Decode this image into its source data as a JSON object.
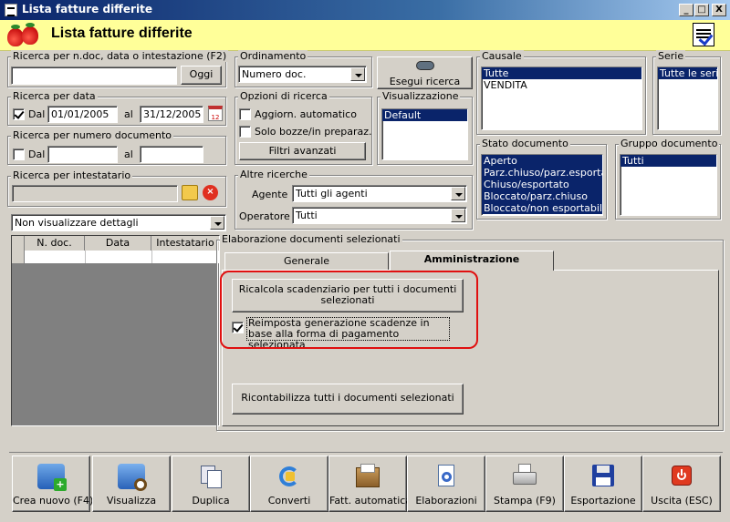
{
  "window": {
    "title": "Lista fatture differite",
    "min": "_",
    "max": "□",
    "close": "X"
  },
  "header": {
    "title": "Lista fatture differite"
  },
  "search_doc": {
    "label": "Ricerca per n.doc, data o intestazione (F2)",
    "value": "",
    "button": "Oggi"
  },
  "search_date": {
    "label": "Ricerca per data",
    "checked": true,
    "from_label": "Dal",
    "from": "01/01/2005",
    "to_label": "al",
    "to": "31/12/2005",
    "calendar_icon": "12"
  },
  "search_num": {
    "label": "Ricerca per numero documento",
    "from_label": "Dal",
    "to_label": "al",
    "from": "",
    "to": ""
  },
  "search_holder": {
    "label": "Ricerca per intestatario",
    "value": ""
  },
  "details": {
    "selected": "Non visualizzare dettagli"
  },
  "grid": {
    "columns": [
      "N. doc.",
      "Data",
      "Intestatario"
    ]
  },
  "ordering": {
    "label": "Ordinamento",
    "selected": "Numero doc."
  },
  "search_button": "Esegui ricerca",
  "options": {
    "label": "Opzioni di ricerca",
    "auto_update": "Aggiorn. automatico",
    "drafts_only": "Solo bozze/in preparaz.",
    "advanced_filters": "Filtri avanzati"
  },
  "view": {
    "label": "Visualizzazione",
    "items": [
      "Default"
    ]
  },
  "causale": {
    "label": "Causale",
    "items": [
      "Tutte",
      "VENDITA"
    ]
  },
  "serie": {
    "label": "Serie",
    "items": [
      "Tutte le serie"
    ]
  },
  "stato": {
    "label": "Stato documento",
    "items": [
      "Aperto",
      "Parz.chiuso/parz.esportato",
      "Chiuso/esportato",
      "Bloccato/parz.chiuso",
      "Bloccato/non esportabile"
    ]
  },
  "gruppo": {
    "label": "Gruppo documento",
    "items": [
      "Tutti"
    ]
  },
  "other": {
    "label": "Altre ricerche",
    "agent_label": "Agente :",
    "agent": "Tutti gli agenti",
    "operator_label": "Operatore :",
    "operator": "Tutti"
  },
  "processing": {
    "label": "Elaborazione documenti selezionati",
    "tabs": [
      "Generale",
      "Amministrazione"
    ],
    "recalc_button": "Ricalcola scadenziario per tutti i documenti selezionati",
    "reset_check": "Reimposta generazione scadenze in base alla forma di pagamento selezionata",
    "reset_checked": true,
    "repost_button": "Ricontabilizza tutti i documenti selezionati"
  },
  "toolbar": [
    {
      "label": "Crea nuovo (F4)",
      "icon": "new-document-icon"
    },
    {
      "label": "Visualizza",
      "icon": "view-document-icon"
    },
    {
      "label": "Duplica",
      "icon": "duplicate-icon"
    },
    {
      "label": "Converti",
      "icon": "convert-icon"
    },
    {
      "label": "Fatt. automatica",
      "icon": "auto-invoice-icon"
    },
    {
      "label": "Elaborazioni",
      "icon": "processing-icon"
    },
    {
      "label": "Stampa (F9)",
      "icon": "printer-icon"
    },
    {
      "label": "Esportazione",
      "icon": "floppy-icon"
    },
    {
      "label": "Uscita (ESC)",
      "icon": "exit-icon"
    }
  ],
  "colors": {
    "selection": "#0a246a",
    "header_bg": "#ffff99",
    "highlight": "#e01010"
  }
}
